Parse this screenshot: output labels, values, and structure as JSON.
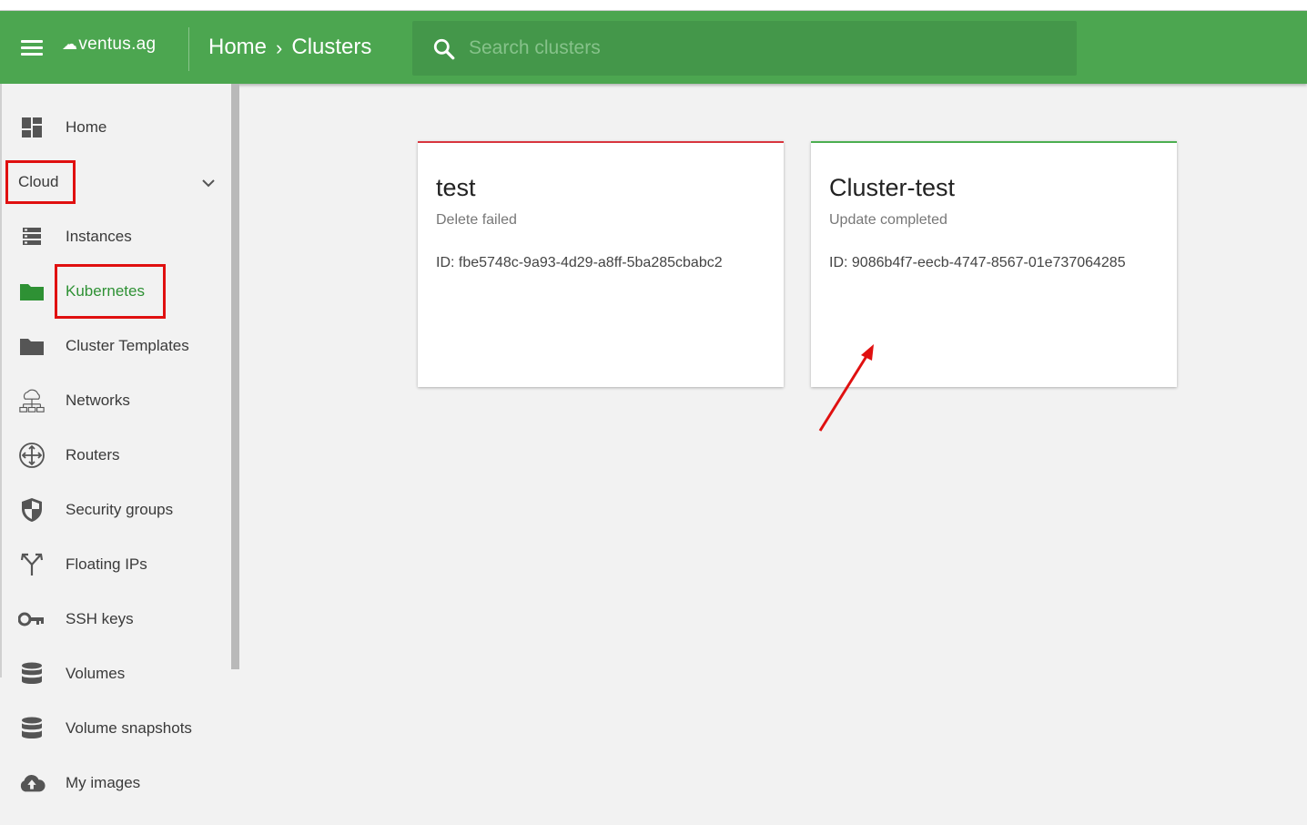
{
  "header": {
    "logo_text": "ventus.ag",
    "logo_mark": "☁",
    "breadcrumb": [
      "Home",
      "Clusters"
    ],
    "breadcrumb_separator": "›",
    "search_placeholder": "Search clusters"
  },
  "sidebar": {
    "items": [
      {
        "label": "Home",
        "icon": "dashboard-icon"
      },
      {
        "label": "Cloud",
        "icon": "chevron-down-icon"
      },
      {
        "label": "Instances",
        "icon": "server-icon"
      },
      {
        "label": "Kubernetes",
        "icon": "folder-icon",
        "active": true
      },
      {
        "label": "Cluster Templates",
        "icon": "folder-icon"
      },
      {
        "label": "Networks",
        "icon": "network-icon"
      },
      {
        "label": "Routers",
        "icon": "router-icon"
      },
      {
        "label": "Security groups",
        "icon": "shield-icon"
      },
      {
        "label": "Floating IPs",
        "icon": "fork-icon"
      },
      {
        "label": "SSH keys",
        "icon": "key-icon"
      },
      {
        "label": "Volumes",
        "icon": "database-icon"
      },
      {
        "label": "Volume snapshots",
        "icon": "database-icon"
      },
      {
        "label": "My images",
        "icon": "cloud-upload-icon"
      }
    ]
  },
  "clusters": [
    {
      "name": "test",
      "status": "Delete failed",
      "id": "ID: fbe5748c-9a93-4d29-a8ff-5ba285cbabc2",
      "status_color": "#d9363e"
    },
    {
      "name": "Cluster-test",
      "status": "Update completed",
      "id": "ID: 9086b4f7-eecb-4747-8567-01e737064285",
      "status_color": "#4caf50"
    }
  ],
  "colors": {
    "brand_green": "#4ca650",
    "active_text": "#2e9134",
    "annotation_red": "#e01010"
  }
}
